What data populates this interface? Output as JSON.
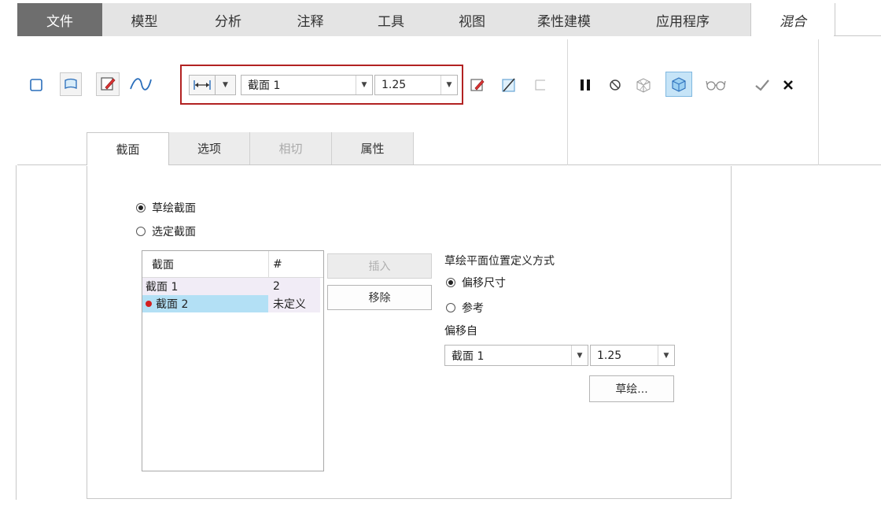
{
  "menu": {
    "file_label": "文件",
    "tabs": [
      "模型",
      "分析",
      "注释",
      "工具",
      "视图",
      "柔性建模",
      "应用程序",
      "混合"
    ],
    "active_tab": "混合"
  },
  "ribbon": {
    "section_combo": {
      "value": "截面 1"
    },
    "offset_combo": {
      "value": "1.25"
    },
    "icons": {
      "solid": "solid-blend-icon",
      "surface": "surface-blend-icon",
      "sketch": "sketch-icon",
      "smooth": "smooth-curve-icon",
      "offset_type": "offset-dimension-icon",
      "edit_sketch": "edit-sketch-icon",
      "remove_material": "remove-material-icon",
      "thicken": "thicken-icon",
      "pause": "pause-icon",
      "no_preview": "no-preview-icon",
      "preview": "preview-icon",
      "verify": "verify-icon",
      "glasses": "glasses-icon",
      "ok": "ok-icon",
      "cancel": "cancel-icon"
    }
  },
  "subtabs": [
    {
      "label": "截面",
      "state": "active"
    },
    {
      "label": "选项",
      "state": "normal"
    },
    {
      "label": "相切",
      "state": "disabled"
    },
    {
      "label": "属性",
      "state": "normal"
    }
  ],
  "panel": {
    "radio_sketch": "草绘截面",
    "radio_select": "选定截面",
    "table": {
      "col_section": "截面",
      "col_num": "#",
      "rows": [
        {
          "name": "截面 1",
          "num": "2"
        },
        {
          "name": "截面 2",
          "num": "未定义"
        }
      ]
    },
    "insert_button": "插入",
    "remove_button": "移除",
    "placement_title": "草绘平面位置定义方式",
    "radio_offset": "偏移尺寸",
    "radio_reference": "参考",
    "offset_from_label": "偏移自",
    "offset_from_value": "截面 1",
    "offset_value": "1.25",
    "sketch_button": "草绘..."
  },
  "colors": {
    "highlight_border": "#b22222",
    "selected_row": "#b3e0f5",
    "table_row_bg": "#f1ecf6",
    "undefined_marker": "#d32020"
  }
}
